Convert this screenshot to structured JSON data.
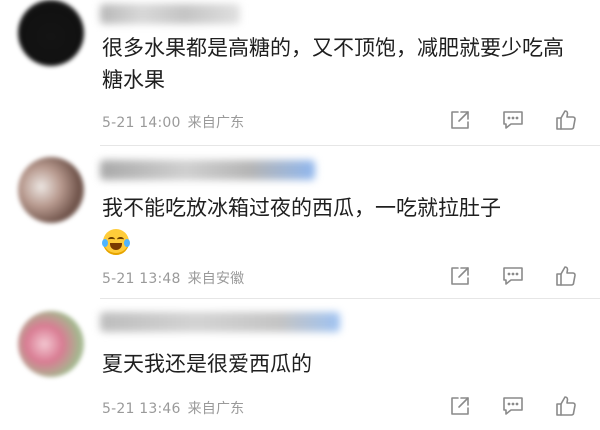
{
  "comments": [
    {
      "text": "很多水果都是高糖的，又不顶饱，减肥就要少吃高糖水果",
      "time": "5-21 14:00",
      "location": "来自广东",
      "avatar_color": "#141414",
      "nickname_visible": false
    },
    {
      "text": "我不能吃放冰箱过夜的西瓜，一吃就拉肚子",
      "emoji": "laughing-with-tears-emoji",
      "time": "5-21 13:48",
      "location": "来自安徽",
      "avatar_color": "#b89a8f",
      "nickname_visible": false
    },
    {
      "text": "夏天我还是很爱西瓜的",
      "time": "5-21 13:46",
      "location": "来自广东",
      "avatar_color": "#d97c93",
      "nickname_visible": false
    }
  ],
  "actions": {
    "icons": [
      "share-icon",
      "reply-comment-icon",
      "like-thumb-icon"
    ],
    "icon_color": "#8a8a8a"
  },
  "colors": {
    "text": "#1f1f1f",
    "meta": "#9a9a9a",
    "divider": "#e6e6e6"
  }
}
